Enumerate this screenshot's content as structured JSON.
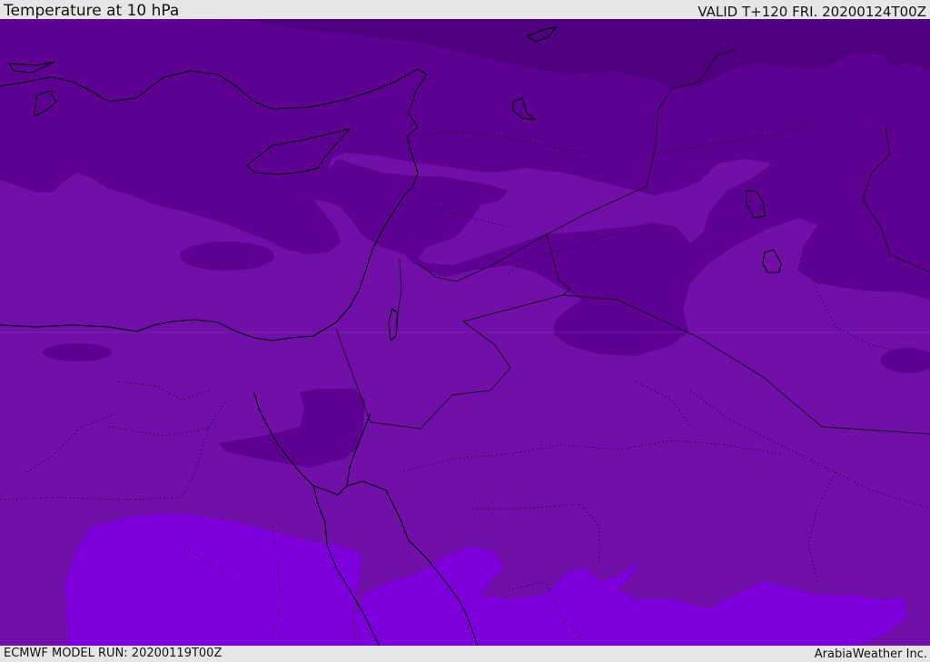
{
  "header": {
    "title": "Temperature at 10 hPa",
    "valid": "VALID T+120 FRI. 20200124T00Z"
  },
  "footer": {
    "model_run": "ECMWF MODEL RUN: 20200119T00Z",
    "credit": "ArabiaWeather Inc."
  },
  "map": {
    "field": "Temperature at 10 hPa",
    "colors": {
      "band_darkest": "#4f007e",
      "band_dark": "#5e0092",
      "band_mid": "#7010a8",
      "band_bright": "#7d00dc",
      "coastline": "#000000"
    }
  }
}
